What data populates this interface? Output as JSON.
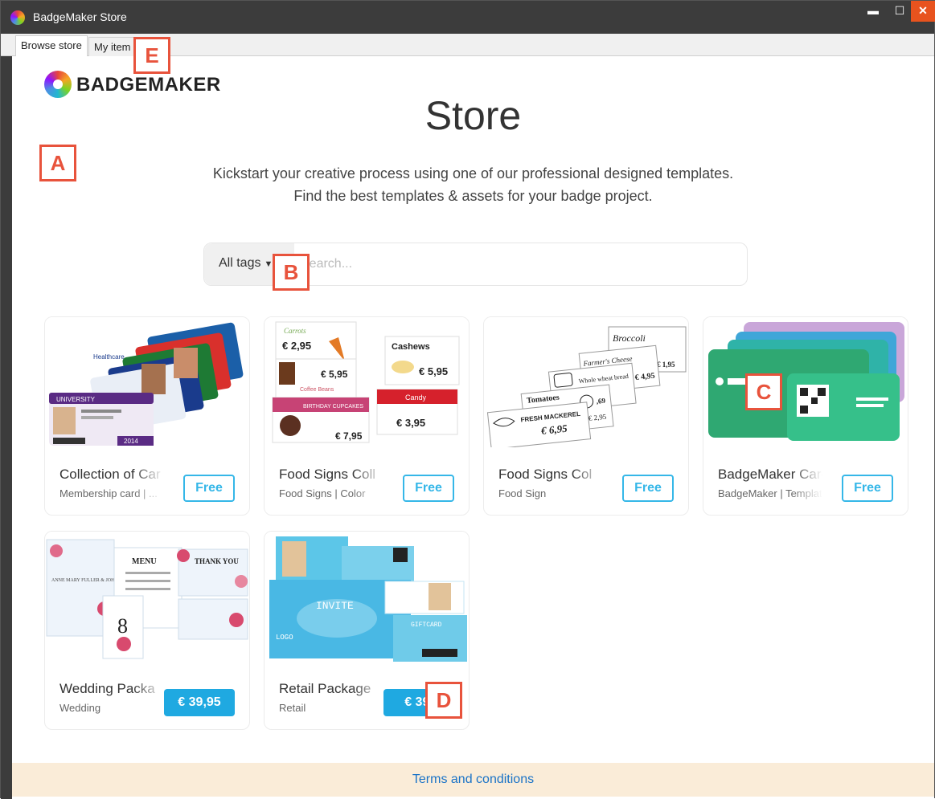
{
  "window": {
    "title": "BadgeMaker Store",
    "controls": {
      "minimize": "▬",
      "maximize": "☐",
      "close": "✕"
    }
  },
  "tabs": [
    {
      "label": "Browse store",
      "active": true
    },
    {
      "label": "My item"
    }
  ],
  "header": {
    "logo_text": "BADGEMAKER",
    "title": "Store",
    "subtitle_line1": "Kickstart your creative process using one of our professional designed templates.",
    "subtitle_line2": "Find the best templates & assets for your badge project."
  },
  "search": {
    "tags_label": "All tags",
    "placeholder": "Search..."
  },
  "products": [
    {
      "name": "Collection of Car",
      "tags": "Membership card | ...",
      "price": "Free",
      "paid": false
    },
    {
      "name": "Food Signs Coll",
      "tags": "Food Signs | Color",
      "price": "Free",
      "paid": false
    },
    {
      "name": "Food Signs Col",
      "tags": "Food Sign",
      "price": "Free",
      "paid": false
    },
    {
      "name": "BadgeMaker Card",
      "tags": "BadgeMaker | Templat",
      "price": "Free",
      "paid": false
    },
    {
      "name": "Wedding Packa",
      "tags": "Wedding",
      "price": "€ 39,95",
      "paid": true
    },
    {
      "name": "Retail Package",
      "tags": "Retail",
      "price": "€ 39,",
      "paid": true
    }
  ],
  "thumbnail_text": {
    "cards_university": "UNIVERSITY",
    "cards_health": "Healthcare",
    "cards_year": "2014",
    "food1_carrots": "Carrots",
    "food1_carrot_price": "€ 2,95",
    "food1_cashews": "Cashews",
    "food1_cashew_price": "€ 5,95",
    "food1_coffee_price": "€ 5,95",
    "food1_coffee": "Coffee Beans",
    "food1_candy": "Candy",
    "food1_candy_price": "€ 3,95",
    "food1_cupcakes": "BIRTHDAY CUPCAKES",
    "food1_cupcake_price": "€ 7,95",
    "food2_broccoli": "Broccoli",
    "food2_broccoli_price": "€ 1,95",
    "food2_cheese": "Farmer's Cheese",
    "food2_cheese_price": "€ 4,95",
    "food2_bread": "Whole wheat bread",
    "food2_tomatoes": "Tomatoes",
    "food2_tomato_price": "€ 2,95",
    "food2_fish": "FRESH MACKEREL",
    "food2_fish_price": "€ 6,95",
    "food2_apple_price": ",69",
    "wedding_menu": "MENU",
    "wedding_thanks": "THANK YOU",
    "wedding_table": "8",
    "wedding_names": "ANNE MARY FULLER & JOHN FRANKLIN DOE",
    "retail_invite": "INVITE",
    "retail_giftcard": "GIFTCARD",
    "retail_logo": "LOGO"
  },
  "footer": {
    "terms": "Terms and conditions"
  },
  "markers": {
    "a": "A",
    "b": "B",
    "c": "C",
    "d": "D",
    "e": "E"
  },
  "colors": {
    "accent": "#35b7e8",
    "price_button": "#1fa9e1",
    "footer_bg": "#faecd8",
    "marker": "#e8533c"
  }
}
